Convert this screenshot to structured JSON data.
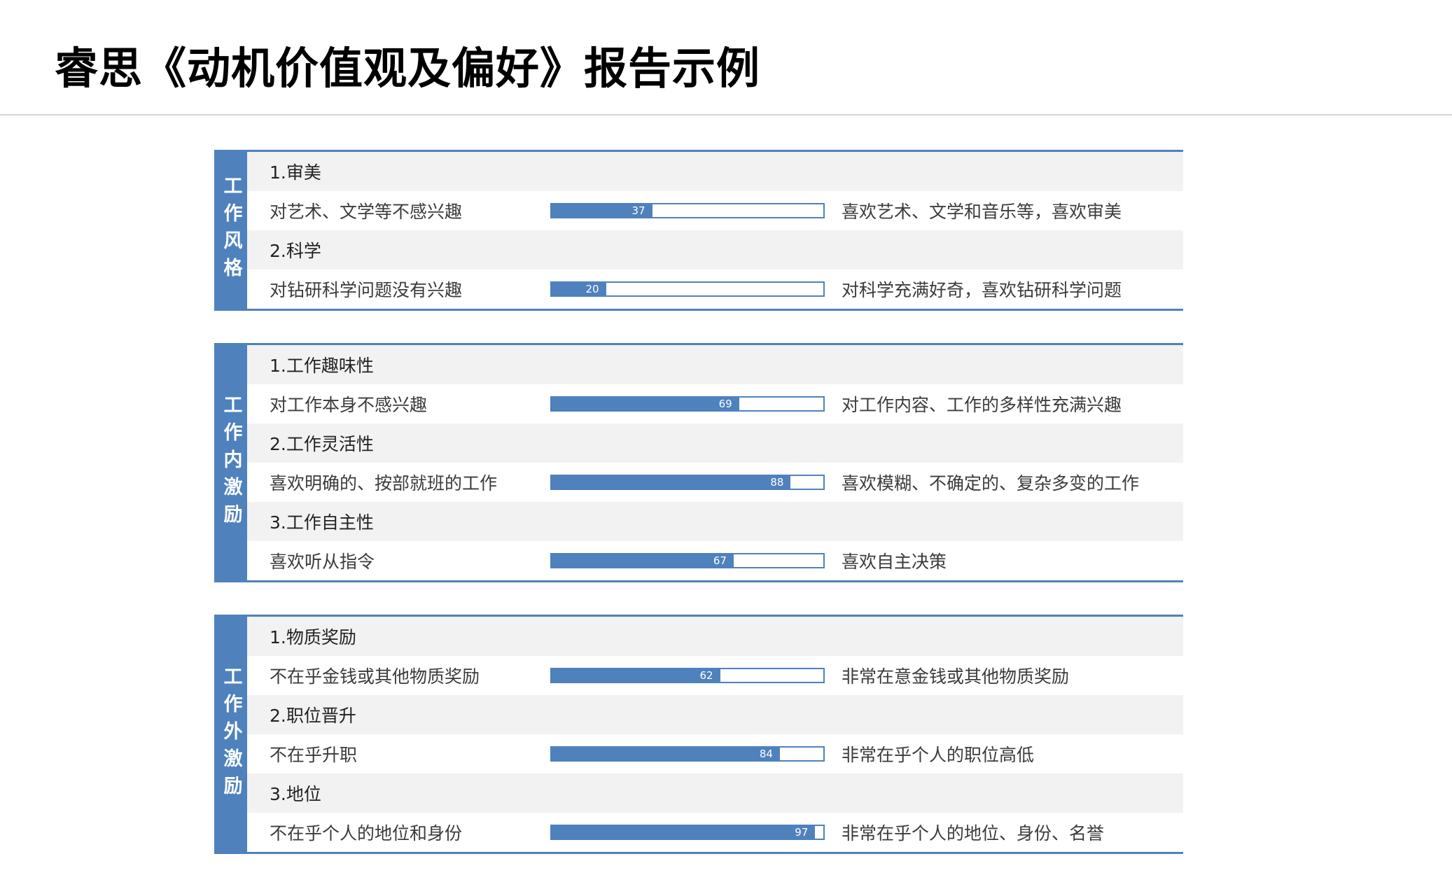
{
  "title": "睿思《动机价值观及偏好》报告示例",
  "sections": [
    {
      "label": "工作风格",
      "items": [
        {
          "heading": "1.审美",
          "left": "对艺术、文学等不感兴趣",
          "value": 37,
          "right": "喜欢艺术、文学和音乐等，喜欢审美"
        },
        {
          "heading": "2.科学",
          "left": "对钻研科学问题没有兴趣",
          "value": 20,
          "right": "对科学充满好奇，喜欢钻研科学问题"
        }
      ]
    },
    {
      "label": "工作内激励",
      "items": [
        {
          "heading": "1.工作趣味性",
          "left": "对工作本身不感兴趣",
          "value": 69,
          "right": "对工作内容、工作的多样性充满兴趣"
        },
        {
          "heading": "2.工作灵活性",
          "left": "喜欢明确的、按部就班的工作",
          "value": 88,
          "right": "喜欢模糊、不确定的、复杂多变的工作"
        },
        {
          "heading": "3.工作自主性",
          "left": "喜欢听从指令",
          "value": 67,
          "right": "喜欢自主决策"
        }
      ]
    },
    {
      "label": "工作外激励",
      "items": [
        {
          "heading": "1.物质奖励",
          "left": "不在乎金钱或其他物质奖励",
          "value": 62,
          "right": "非常在意金钱或其他物质奖励"
        },
        {
          "heading": "2.职位晋升",
          "left": "不在乎升职",
          "value": 84,
          "right": "非常在乎个人的职位高低"
        },
        {
          "heading": "3.地位",
          "left": "不在乎个人的地位和身份",
          "value": 97,
          "right": "非常在乎个人的地位、身份、名誉"
        }
      ]
    }
  ],
  "colors": {
    "accent": "#4f81bd",
    "heading_bg": "#f2f2f2"
  }
}
